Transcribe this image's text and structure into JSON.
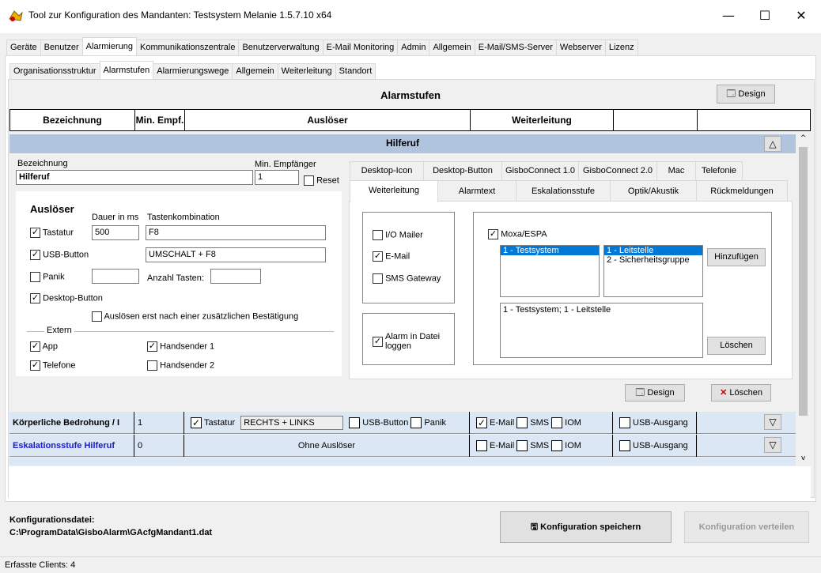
{
  "window": {
    "title": "Tool zur Konfiguration des Mandanten: Testsystem Melanie 1.5.7.10 x64",
    "min": "—",
    "max": "☐",
    "close": "✕"
  },
  "tabs_main": [
    "Geräte",
    "Benutzer",
    "Alarmierung",
    "Kommunikationszentrale",
    "Benutzerverwaltung",
    "E-Mail Monitoring",
    "Admin",
    "Allgemein",
    "E-Mail/SMS-Server",
    "Webserver",
    "Lizenz"
  ],
  "tabs_sub": [
    "Organisationsstruktur",
    "Alarmstufen",
    "Alarmierungswege",
    "Allgemein",
    "Weiterleitung",
    "Standort"
  ],
  "page": {
    "title": "Alarmstufen",
    "design_label": "Design"
  },
  "table_header": {
    "bezeichnung": "Bezeichnung",
    "min_empf": "Min. Empf.",
    "ausloeser": "Auslöser",
    "weiterleitung": "Weiterleitung"
  },
  "section": {
    "title": "Hilferuf",
    "collapse": "△"
  },
  "form": {
    "bezeichnung_label": "Bezeichnung",
    "bezeichnung_value": "Hilferuf",
    "min_empf_label": "Min. Empfänger",
    "min_empf_value": "1",
    "reset_label": "Reset",
    "ausloeser_title": "Auslöser",
    "dauer_label": "Dauer in ms",
    "tasten_label": "Tastenkombination",
    "tastatur_label": "Tastatur",
    "tastatur_dauer": "500",
    "tastatur_keys": "F8",
    "usb_label": "USB-Button",
    "usb_keys": "UMSCHALT + F8",
    "panik_label": "Panik",
    "anzahl_label": "Anzahl Tasten:",
    "desktop_label": "Desktop-Button",
    "bestaetigung_label": "Auslösen erst nach einer zusätzlichen Bestätigung",
    "extern_label": "Extern",
    "app_label": "App",
    "handsender1_label": "Handsender 1",
    "telefone_label": "Telefone",
    "handsender2_label": "Handsender 2"
  },
  "right_tabs_row1": [
    "Desktop-Icon",
    "Desktop-Button",
    "GisboConnect 1.0",
    "GisboConnect 2.0",
    "Mac",
    "Telefonie"
  ],
  "right_tabs_row2": [
    "Weiterleitung",
    "Alarmtext",
    "Eskalationsstufe",
    "Optik/Akustik",
    "Rückmeldungen"
  ],
  "weiterleitung": {
    "io_mailer": "I/O Mailer",
    "email": "E-Mail",
    "sms_gateway": "SMS Gateway",
    "alarm_datei": "Alarm in Datei loggen",
    "moxa": "Moxa/ESPA",
    "list1": [
      "1 - Testsystem"
    ],
    "list2": [
      "1 - Leitstelle",
      "2 - Sicherheitsgruppe"
    ],
    "hinzufuegen": "Hinzufügen",
    "result": "1 - Testsystem; 1 - Leitstelle",
    "loeschen": "Löschen"
  },
  "bottom_buttons": {
    "design": "Design",
    "loeschen": "Löschen"
  },
  "rows": [
    {
      "name": "Körperliche Bedrohung / I",
      "min": "1",
      "tastatur": "Tastatur",
      "keys": "RECHTS + LINKS",
      "usb": "USB-Button",
      "panik": "Panik",
      "email": "E-Mail",
      "sms": "SMS",
      "iom": "IOM",
      "usb_out": "USB-Ausgang",
      "toggle": "▽"
    },
    {
      "name": "Eskalationsstufe Hilferuf",
      "min": "0",
      "ausloeser": "Ohne Auslöser",
      "email": "E-Mail",
      "sms": "SMS",
      "iom": "IOM",
      "usb_out": "USB-Ausgang",
      "toggle": "▽"
    }
  ],
  "footer": {
    "config_label": "Konfigurationsdatei:",
    "config_path": "C:\\ProgramData\\GisboAlarm\\GAcfgMandant1.dat",
    "save": "Konfiguration speichern",
    "distribute": "Konfiguration verteilen"
  },
  "status": {
    "clients": "Erfasste Clients: 4"
  },
  "colors": {
    "section_bg": "#b0c4de",
    "row_name_blue": "#1a1ad0",
    "selection": "#0078d7"
  }
}
